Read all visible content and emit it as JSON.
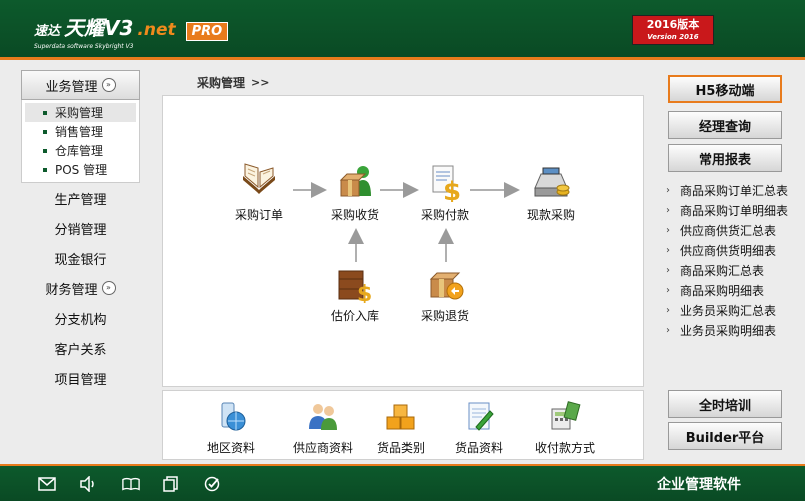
{
  "header": {
    "logo_cn": "速达",
    "logo_main": "天耀V3",
    "logo_net": ".net",
    "logo_pro": "PRO",
    "logo_sub": "Superdata software Skybright V3",
    "version_line1": "2016版本",
    "version_line2": "Version 2016"
  },
  "sidebar": {
    "dept_header": "业务管理",
    "sub_items": [
      {
        "label": "采购管理"
      },
      {
        "label": "销售管理"
      },
      {
        "label": "仓库管理"
      },
      {
        "label": "POS 管理"
      }
    ],
    "nav_items": [
      {
        "label": "生产管理"
      },
      {
        "label": "分销管理"
      },
      {
        "label": "现金银行"
      },
      {
        "label": "财务管理"
      },
      {
        "label": "分支机构"
      },
      {
        "label": "客户关系"
      },
      {
        "label": "项目管理"
      }
    ]
  },
  "breadcrumb": {
    "label": "采购管理",
    "arrow": ">>"
  },
  "flow": {
    "nodes": [
      {
        "label": "采购订单"
      },
      {
        "label": "采购收货"
      },
      {
        "label": "采购付款"
      },
      {
        "label": "现款采购"
      },
      {
        "label": "估价入库"
      },
      {
        "label": "采购退货"
      }
    ]
  },
  "bottom": {
    "items": [
      {
        "label": "地区资料"
      },
      {
        "label": "供应商资料"
      },
      {
        "label": "货品类别"
      },
      {
        "label": "货品资料"
      },
      {
        "label": "收付款方式"
      }
    ]
  },
  "right_panel": {
    "h5": "H5移动端",
    "manager_query": "经理查询",
    "common_reports": "常用报表",
    "reports": [
      {
        "label": "商品采购订单汇总表"
      },
      {
        "label": "商品采购订单明细表"
      },
      {
        "label": "供应商供货汇总表"
      },
      {
        "label": "供应商供货明细表"
      },
      {
        "label": "商品采购汇总表"
      },
      {
        "label": "商品采购明细表"
      },
      {
        "label": "业务员采购汇总表"
      },
      {
        "label": "业务员采购明细表"
      }
    ],
    "training": "全时培训",
    "builder": "Builder平台"
  },
  "footer": {
    "text": "企业管理软件"
  },
  "colors": {
    "header_green": "#0d5a2c",
    "accent_orange": "#e87b1c",
    "version_red": "#c9181b"
  }
}
